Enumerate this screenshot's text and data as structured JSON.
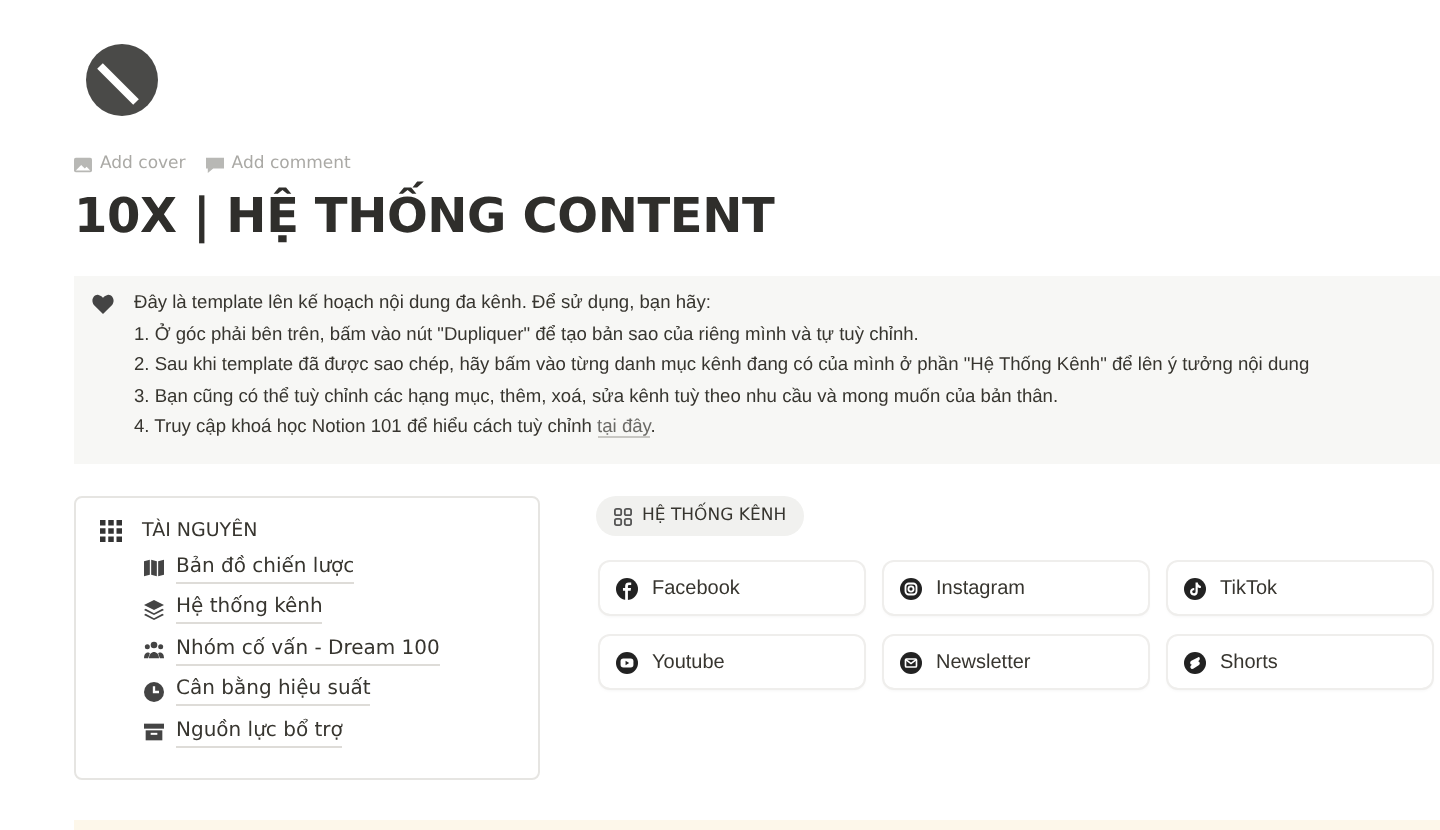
{
  "page": {
    "actions": [
      "Add cover",
      "Add comment"
    ],
    "title": "10X | HỆ THỐNG CONTENT"
  },
  "callout": {
    "intro": "Đây là template lên kế hoạch nội dung đa kênh. Để sử dụng, bạn hãy:",
    "steps": [
      {
        "text": "1. Ở góc phải bên trên, bấm vào nút \"Dupliquer\" để tạo bản sao của riêng mình và tự tuỳ chỉnh."
      },
      {
        "text": "2. Sau khi template đã được sao chép, hãy bấm vào từng danh mục kênh đang có của mình ở phần \"Hệ Thống Kênh\" để lên ý tưởng nội dung"
      },
      {
        "text": "3. Bạn cũng có thể tuỳ chỉnh các hạng mục, thêm, xoá, sửa kênh tuỳ theo nhu cầu và mong muốn của bản thân."
      },
      {
        "text": "4. Truy cập khoá học Notion 101 để hiểu cách tuỳ chỉnh ",
        "link": "tại đây",
        "after": "."
      }
    ]
  },
  "resources": {
    "heading": "TÀI NGUYÊN",
    "items": [
      {
        "kind": "map",
        "label": "Bản đồ chiến lược"
      },
      {
        "kind": "layers",
        "label": "Hệ thống kênh"
      },
      {
        "kind": "people",
        "label": "Nhóm cố vấn - Dream 100"
      },
      {
        "kind": "clock",
        "label": "Cân bằng hiệu suất"
      },
      {
        "kind": "archive",
        "label": "Nguồn lực bổ trợ"
      }
    ]
  },
  "channels": {
    "tag": "HỆ THỐNG KÊNH",
    "items": [
      {
        "kind": "facebook",
        "label": "Facebook"
      },
      {
        "kind": "instagram",
        "label": "Instagram"
      },
      {
        "kind": "tiktok",
        "label": "TikTok"
      },
      {
        "kind": "youtube",
        "label": "Youtube"
      },
      {
        "kind": "mail",
        "label": "Newsletter"
      },
      {
        "kind": "shorts",
        "label": "Shorts"
      }
    ]
  }
}
